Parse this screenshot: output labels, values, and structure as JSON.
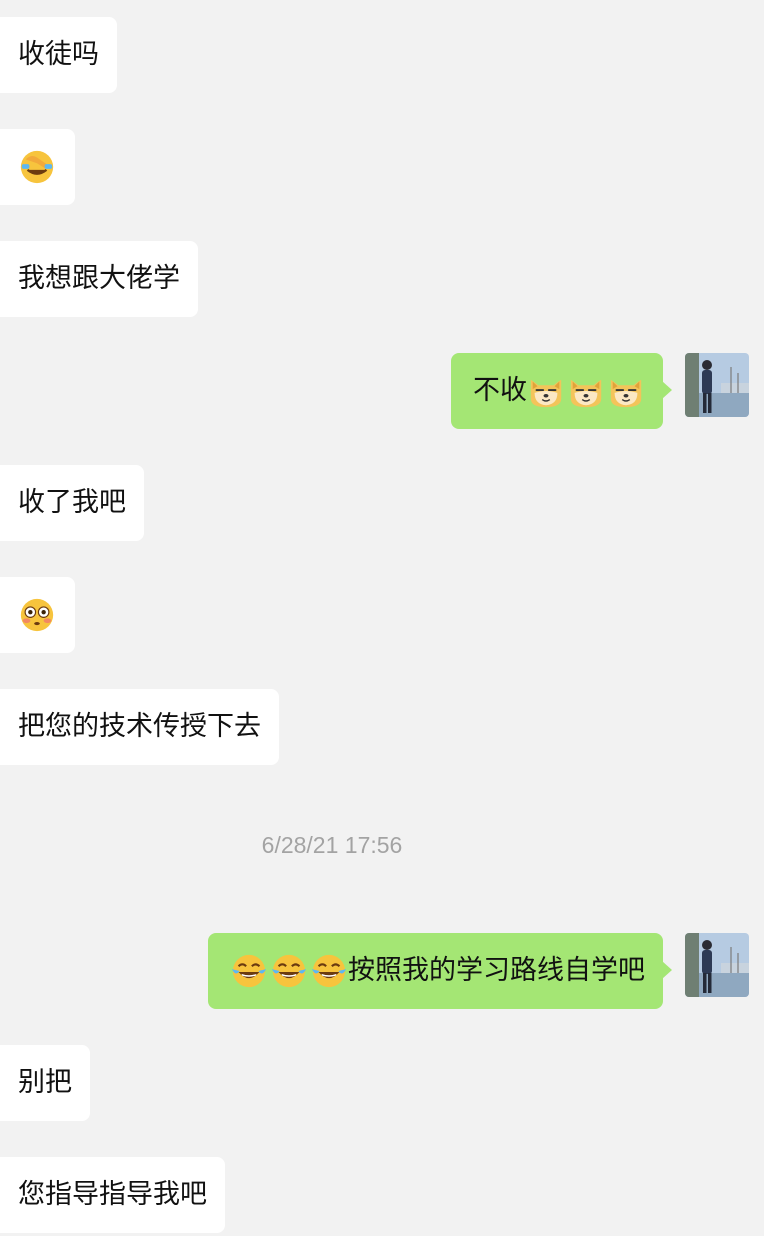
{
  "chat": {
    "messages": [
      {
        "side": "incoming",
        "text": "收徒吗"
      },
      {
        "side": "incoming",
        "emoji": "facepalm-emoji"
      },
      {
        "side": "incoming",
        "text": "我想跟大佬学"
      },
      {
        "side": "outgoing",
        "text": "不收",
        "trailing_emojis": [
          "doge-emoji",
          "doge-emoji",
          "doge-emoji"
        ]
      },
      {
        "side": "incoming",
        "text": "收了我吧"
      },
      {
        "side": "incoming",
        "emoji": "flushed-face-emoji"
      },
      {
        "side": "incoming",
        "text": "把您的技术传授下去"
      },
      {
        "side": "outgoing",
        "leading_emojis": [
          "tears-of-joy-emoji",
          "tears-of-joy-emoji",
          "tears-of-joy-emoji"
        ],
        "text": "按照我的学习路线自学吧"
      },
      {
        "side": "incoming",
        "text": "别把"
      },
      {
        "side": "incoming",
        "text": "您指导指导我吧"
      }
    ],
    "timestamp": "6/28/21 17:56"
  },
  "colors": {
    "background": "#f2f2f2",
    "incoming_bubble": "#ffffff",
    "outgoing_bubble": "#a4e674",
    "timestamp_text": "#a3a3a3"
  }
}
